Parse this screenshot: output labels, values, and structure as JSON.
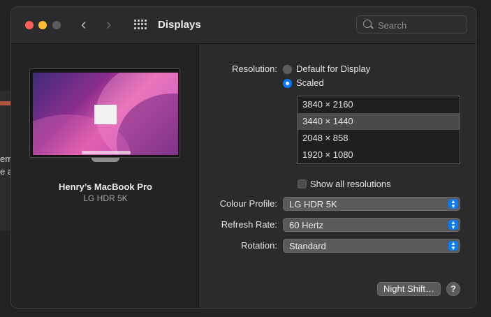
{
  "window": {
    "title": "Displays"
  },
  "search": {
    "placeholder": "Search"
  },
  "background_app": {
    "fragment_1": "em",
    "fragment_2": "e a"
  },
  "display": {
    "name": "Henry’s MacBook Pro",
    "model": "LG HDR 5K"
  },
  "resolution": {
    "label": "Resolution:",
    "options": [
      "Default for Display",
      "Scaled"
    ],
    "selected_option": "Scaled",
    "scaled_list": [
      "3840 × 2160",
      "3440 × 1440",
      "2048 × 858",
      "1920 × 1080"
    ],
    "selected_scaled": "3440 × 1440"
  },
  "show_all": {
    "label": "Show all resolutions",
    "checked": false
  },
  "colour_profile": {
    "label": "Colour Profile:",
    "value": "LG HDR 5K"
  },
  "refresh_rate": {
    "label": "Refresh Rate:",
    "value": "60 Hertz"
  },
  "rotation": {
    "label": "Rotation:",
    "value": "Standard"
  },
  "buttons": {
    "night_shift": "Night Shift…",
    "help": "?"
  },
  "icons": {
    "back": "chevron-left-icon",
    "forward": "chevron-right-icon",
    "grid": "grid-icon",
    "search": "search-icon",
    "popup": "chevron-updown-icon"
  },
  "colors": {
    "accent": "#0a7aff",
    "close": "#fe5f57",
    "minimize": "#febc2e"
  }
}
